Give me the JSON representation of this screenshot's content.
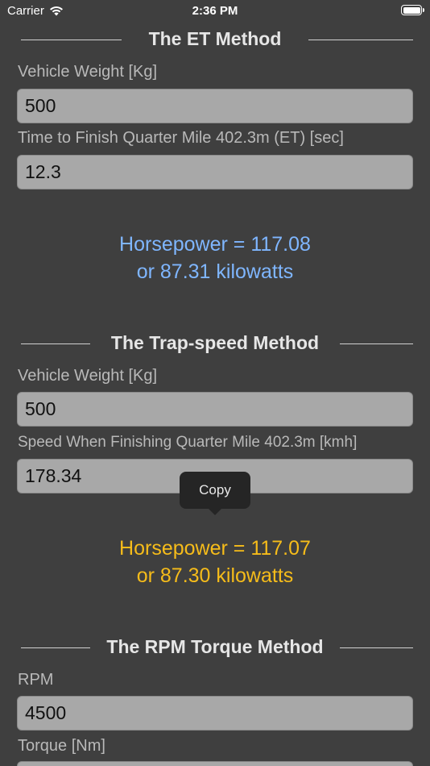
{
  "status_bar": {
    "carrier": "Carrier",
    "time": "2:36 PM"
  },
  "et_method": {
    "title": "The ET Method",
    "weight_label": "Vehicle Weight [Kg]",
    "weight_value": "500",
    "et_label": "Time to Finish Quarter Mile 402.3m (ET) [sec]",
    "et_value": "12.3",
    "result_hp": "Horsepower = 117.08",
    "result_kw": "or 87.31 kilowatts"
  },
  "trap_method": {
    "title": "The Trap-speed Method",
    "weight_label": "Vehicle Weight [Kg]",
    "weight_value": "500",
    "speed_label": "Speed When Finishing Quarter Mile 402.3m [kmh]",
    "speed_value": "178.34",
    "result_hp": "Horsepower = 117.07",
    "result_kw": "or 87.30 kilowatts"
  },
  "rpm_method": {
    "title": "The RPM Torque Method",
    "rpm_label": "RPM",
    "rpm_value": "4500",
    "torque_label": "Torque [Nm]"
  },
  "tooltip": {
    "copy_label": "Copy"
  },
  "colors": {
    "background": "#3f3f3f",
    "result_blue": "#7fb6ff",
    "result_yellow": "#f6bc1a",
    "input_bg": "#a8a8a8"
  }
}
